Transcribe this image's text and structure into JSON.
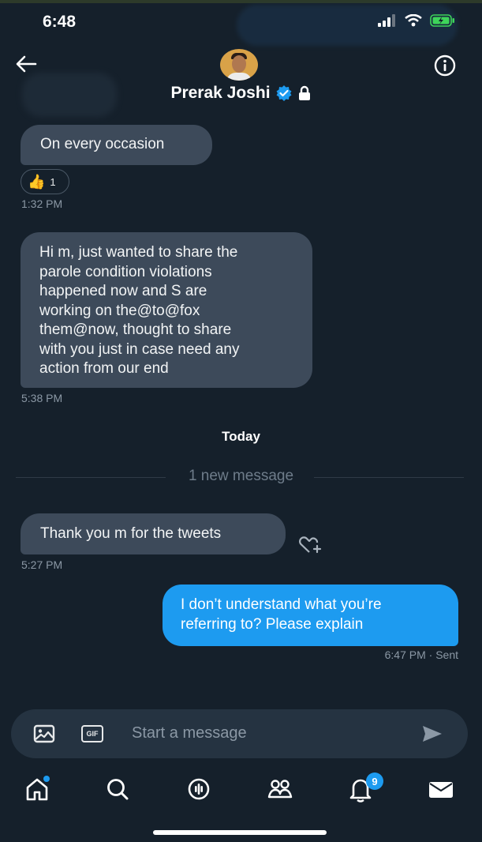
{
  "status_bar": {
    "time": "6:48"
  },
  "header": {
    "name": "Prerak Joshi",
    "verified_icon": "verified-badge-icon",
    "lock_icon": "lock-icon"
  },
  "messages": [
    {
      "text": "On every occasion",
      "direction": "in"
    },
    {
      "reaction_count": "1",
      "reaction_emoji": "👍",
      "timestamp": "1:32 PM"
    },
    {
      "lines": [
        "Hi m, just wanted to share the",
        "parole condition violations",
        "happened now and S are",
        "working on the@to@fox",
        "them@now, thought to share",
        "with you just in case need any",
        "action from our end"
      ],
      "timestamp": "5:38 PM",
      "direction": "in"
    },
    {
      "text": "Thank you m for the tweets",
      "timestamp": "5:27 PM",
      "direction": "in"
    },
    {
      "lines": [
        "I don’t understand what you’re",
        "referring to?  Please explain"
      ],
      "timestamp": "6:47 PM · Sent",
      "direction": "out"
    }
  ],
  "day_label": "Today",
  "new_message_divider": "1 new message",
  "composer": {
    "placeholder": "Start a message"
  },
  "nav": {
    "notifications_badge": "9"
  },
  "colors": {
    "background": "#15202b",
    "bubble_in": "#3d4a5a",
    "bubble_out": "#1d9bf0",
    "accent": "#1d9bf0"
  }
}
